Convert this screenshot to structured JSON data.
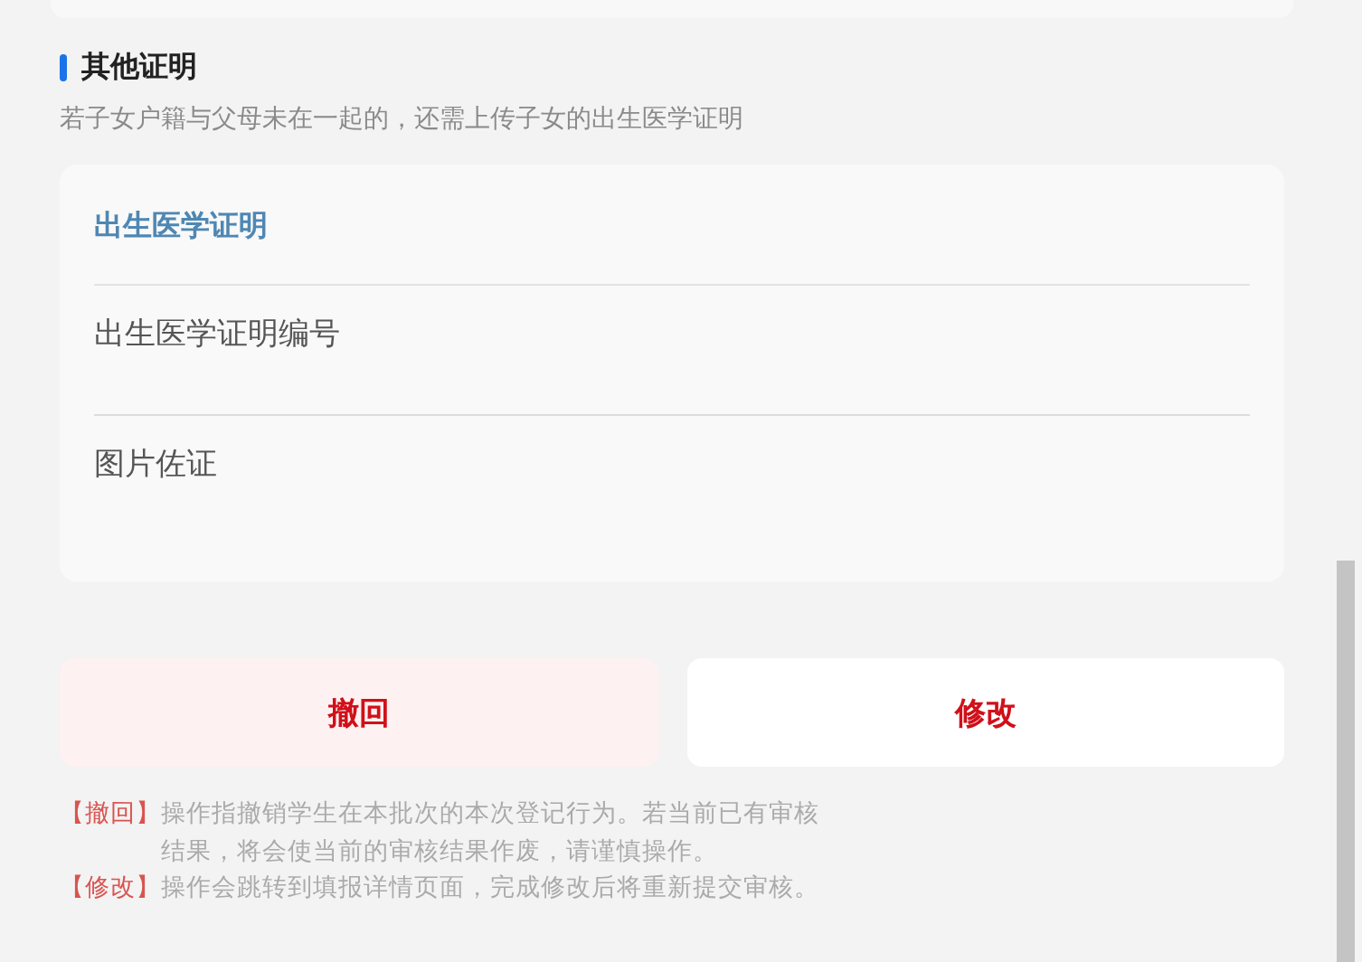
{
  "section": {
    "title": "其他证明",
    "subtitle": "若子女户籍与父母未在一起的，还需上传子女的出生医学证明"
  },
  "card": {
    "title": "出生医学证明",
    "fields": [
      {
        "label": "出生医学证明编号"
      },
      {
        "label": "图片佐证"
      }
    ]
  },
  "buttons": [
    {
      "label": "撤回",
      "kind": "tinted"
    },
    {
      "label": "修改",
      "kind": "plain"
    }
  ],
  "notes": [
    {
      "tag": "【撤回】",
      "text": "操作指撤销学生在本批次的本次登记行为。若当前已有审核结果，将会使当前的审核结果作废，请谨慎操作。"
    },
    {
      "tag": "【修改】",
      "text": "操作会跳转到填报详情页面，完成修改后将重新提交审核。"
    }
  ]
}
